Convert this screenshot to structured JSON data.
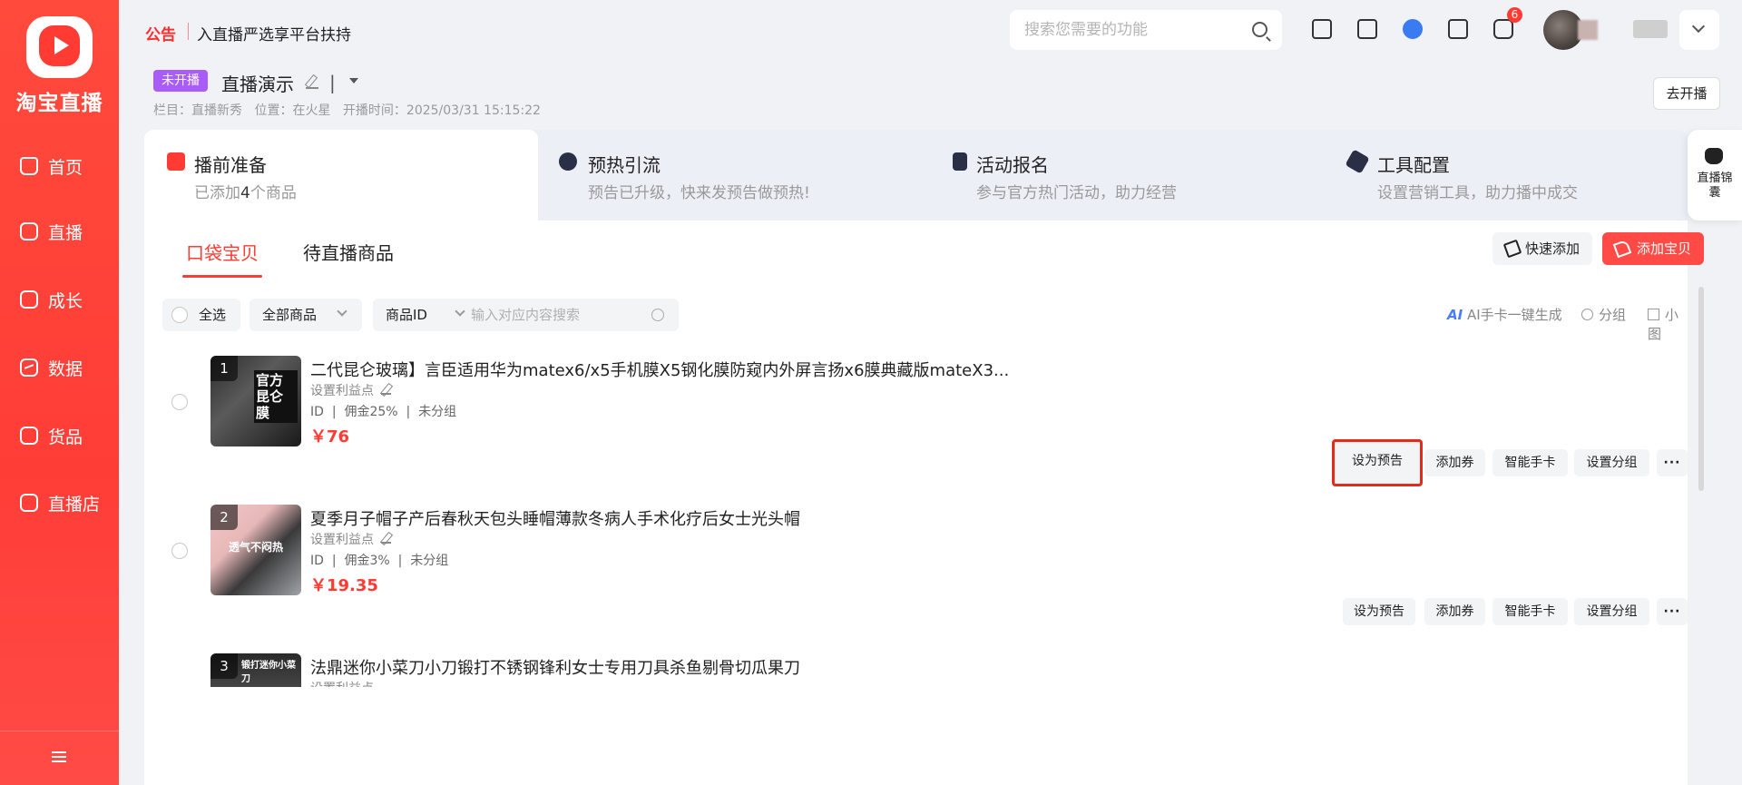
{
  "sidebar": {
    "logo_text": "淘宝直播",
    "items": [
      {
        "label": "首页",
        "icon": "home-icon"
      },
      {
        "label": "直播",
        "icon": "live-icon"
      },
      {
        "label": "成长",
        "icon": "growth-icon"
      },
      {
        "label": "数据",
        "icon": "data-chart-icon"
      },
      {
        "label": "货品",
        "icon": "goods-icon"
      },
      {
        "label": "直播店",
        "icon": "shop-icon"
      }
    ],
    "collapse_icon": "collapse-menu-icon"
  },
  "header": {
    "notice_tag": "公告",
    "notice_text": "入直播严选享平台扶持",
    "search_placeholder": "搜索您需要的功能",
    "notification_count": "6"
  },
  "live": {
    "status": "未开播",
    "title": "直播演示",
    "separator": "|",
    "meta": {
      "column": "栏目：直播新秀",
      "location": "位置：在火星",
      "start_time": "开播时间：2025/03/31 15:15:22"
    },
    "go_live_button": "去开播"
  },
  "steps": [
    {
      "title": "播前准备",
      "subtitle_pre": "已添加",
      "subtitle_count": "4",
      "subtitle_post": "个商品",
      "active": true
    },
    {
      "title": "预热引流",
      "subtitle": "预告已升级，快来发预告做预热!"
    },
    {
      "title": "活动报名",
      "subtitle": "参与官方热门活动，助力经营"
    },
    {
      "title": "工具配置",
      "subtitle": "设置营销工具，助力播中成交"
    }
  ],
  "side_badge": {
    "label": "直播锦囊"
  },
  "subtabs": [
    {
      "label": "口袋宝贝",
      "active": true
    },
    {
      "label": "待直播商品"
    }
  ],
  "actions": {
    "quick_add": "快速添加",
    "add_item": "添加宝贝"
  },
  "filters": {
    "select_all": "全选",
    "category": "全部商品",
    "field": "商品ID",
    "search_placeholder": "输入对应内容搜索"
  },
  "toolbar_right": {
    "ai_label": "AI",
    "ai_text": "AI手卡一键生成",
    "group": "分组",
    "small_view": "小图"
  },
  "products": [
    {
      "index": "1",
      "thumb_text": "官方昆仑膜",
      "title": "二代昆仑玻璃】言臣适用华为matex6/x5手机膜X5钢化膜防窥内外屏言扬x6膜典藏版mateX3...",
      "profit": "设置利益点",
      "id_label": "ID",
      "commission": "佣金25%",
      "group": "未分组",
      "price": "￥76",
      "buttons": [
        "设为预告",
        "添加券",
        "智能手卡",
        "设置分组",
        "···"
      ]
    },
    {
      "index": "2",
      "thumb_text": "透气不闷热",
      "title": "夏季月子帽子产后春秋天包头睡帽薄款冬病人手术化疗后女士光头帽",
      "profit": "设置利益点",
      "id_label": "ID",
      "commission": "佣金3%",
      "group": "未分组",
      "price": "￥19.35",
      "buttons": [
        "设为预告",
        "添加券",
        "智能手卡",
        "设置分组",
        "···"
      ]
    },
    {
      "index": "3",
      "thumb_text": "锻打迷你小菜刀",
      "title": "法鼎迷你小菜刀小刀锻打不锈钢锋利女士专用刀具杀鱼剔骨切瓜果刀",
      "profit": "设置利益点"
    }
  ],
  "colors": {
    "brand_red": "#ff3b33",
    "status_purple": "#a95cf7",
    "highlight_border": "#e52a1a"
  }
}
